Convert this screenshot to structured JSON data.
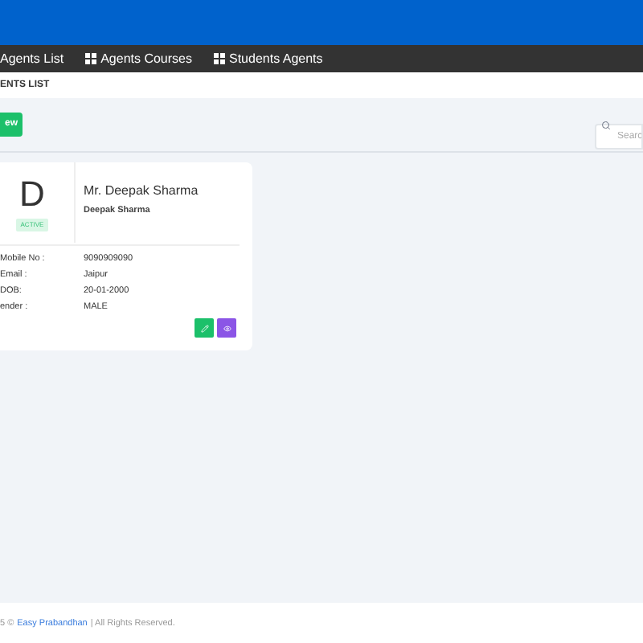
{
  "nav": [
    {
      "label": "Agents List",
      "icon": false
    },
    {
      "label": "Agents Courses",
      "icon": true
    },
    {
      "label": "Students Agents",
      "icon": true
    }
  ],
  "page_title": "ENTS LIST",
  "new_button": "ew",
  "search": {
    "placeholder": "Searc"
  },
  "cards": [
    {
      "initial": "D",
      "status": "ACTIVE",
      "name": "Mr. Deepak Sharma",
      "subname": "Deepak Sharma",
      "fields": [
        {
          "label": "Mobile No :",
          "value": "9090909090"
        },
        {
          "label": "Email :",
          "value": "Jaipur"
        },
        {
          "label": "DOB:",
          "value": "20-01-2000"
        },
        {
          "label": "ender :",
          "value": "MALE"
        }
      ]
    }
  ],
  "footer": {
    "prefix": "5 ©",
    "link": "Easy Prabandhan",
    "suffix": "| All Rights Reserved."
  }
}
